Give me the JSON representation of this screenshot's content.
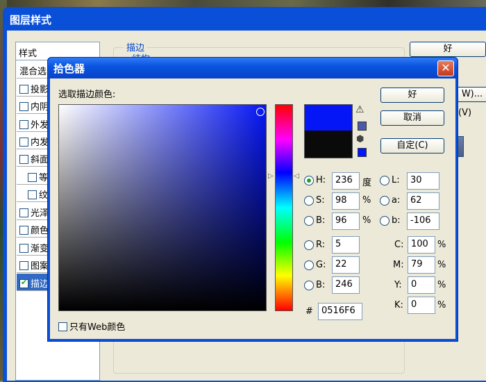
{
  "layer_style": {
    "title": "图层样式",
    "styles_header": "样式",
    "items": [
      {
        "label": "混合选",
        "checkbox": false,
        "checked": false
      },
      {
        "label": "投影",
        "checkbox": true,
        "checked": false
      },
      {
        "label": "内阴",
        "checkbox": true,
        "checked": false
      },
      {
        "label": "外发",
        "checkbox": true,
        "checked": false
      },
      {
        "label": "内发",
        "checkbox": true,
        "checked": false
      },
      {
        "label": "斜面",
        "checkbox": true,
        "checked": false
      },
      {
        "label": "等",
        "checkbox": true,
        "checked": false
      },
      {
        "label": "纹",
        "checkbox": true,
        "checked": false
      },
      {
        "label": "光泽",
        "checkbox": true,
        "checked": false
      },
      {
        "label": "颜色",
        "checkbox": true,
        "checked": false
      },
      {
        "label": "渐变",
        "checkbox": true,
        "checked": false
      },
      {
        "label": "图案",
        "checkbox": true,
        "checked": false
      },
      {
        "label": "描边",
        "checkbox": true,
        "checked": true
      }
    ],
    "group_title": "描边",
    "group_sub": "结构",
    "ok_label": "好",
    "new_style_label": "W)...",
    "preview_label": "(V)"
  },
  "color_picker": {
    "title": "拾色器",
    "close_label": "✕",
    "select_label": "选取描边颜色:",
    "ok_label": "好",
    "cancel_label": "取消",
    "custom_label": "自定(C)",
    "new_color": "#0516F6",
    "old_color": "#0A0A0A",
    "web_only_label": "只有Web颜色",
    "hsb": {
      "h_label": "H:",
      "h": "236",
      "h_unit": "度",
      "s_label": "S:",
      "s": "98",
      "s_unit": "%",
      "b_label": "B:",
      "b": "96",
      "b_unit": "%"
    },
    "rgb": {
      "r_label": "R:",
      "r": "5",
      "g_label": "G:",
      "g": "22",
      "b_label": "B:",
      "b": "246"
    },
    "lab": {
      "l_label": "L:",
      "l": "30",
      "a_label": "a:",
      "a": "62",
      "b_label": "b:",
      "b": "-106"
    },
    "cmyk": {
      "c_label": "C:",
      "c": "100",
      "m_label": "M:",
      "m": "79",
      "y_label": "Y:",
      "y": "0",
      "k_label": "K:",
      "k": "0",
      "unit": "%"
    },
    "hex_label": "#",
    "hex": "0516F6",
    "selected_mode": "H"
  },
  "icons": {
    "warn": "⚠",
    "cube": "⬢",
    "arrow_l": "▷",
    "arrow_r": "◁",
    "check": "✔"
  }
}
